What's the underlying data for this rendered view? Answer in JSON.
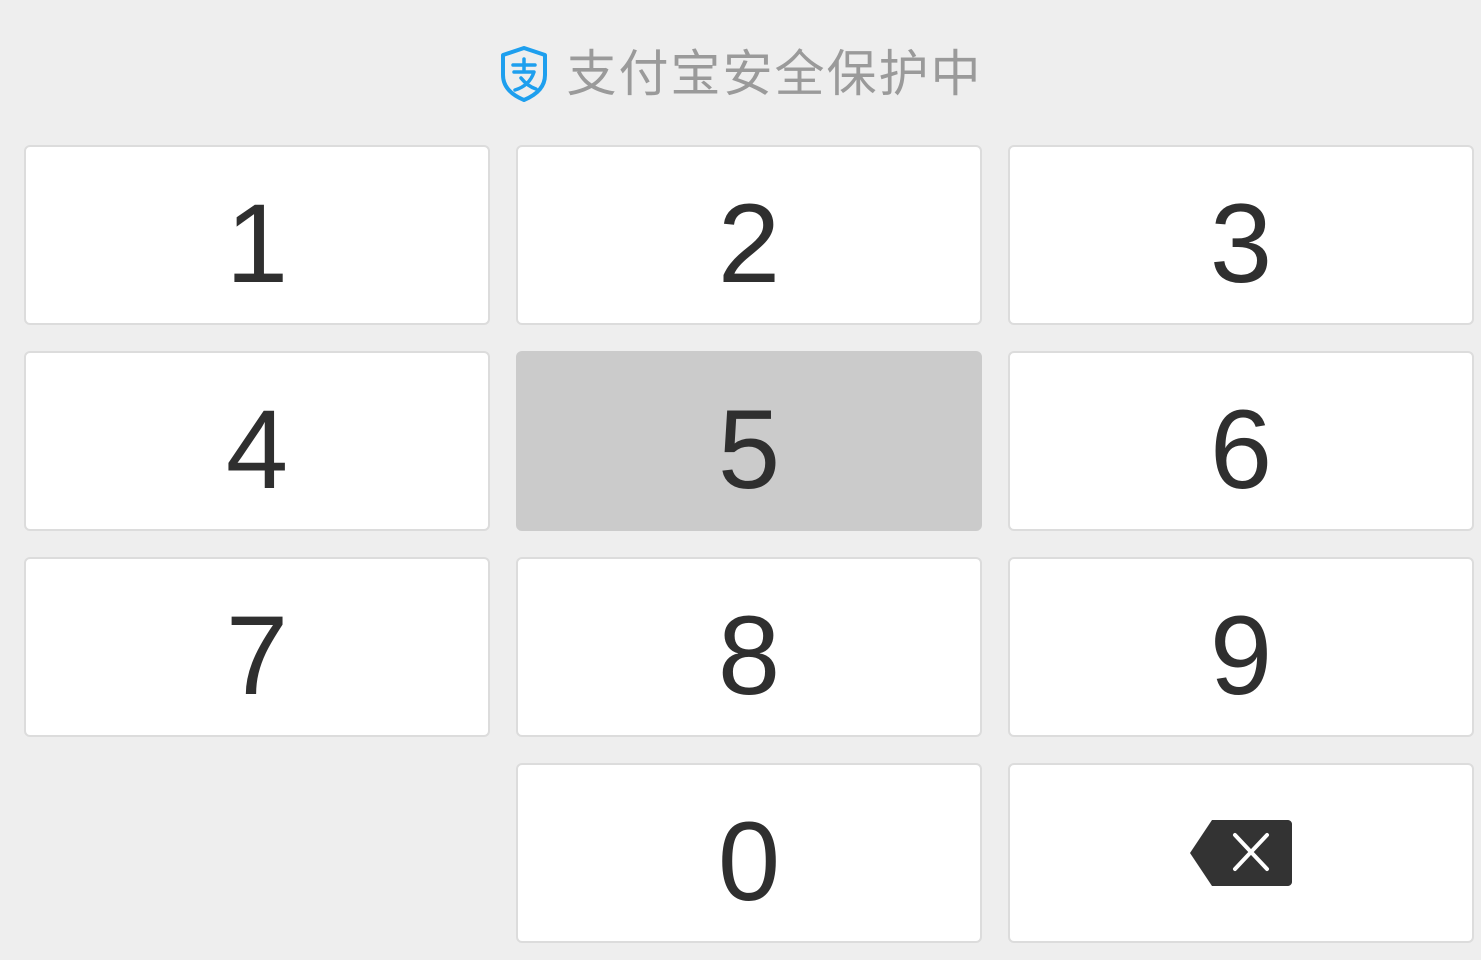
{
  "header": {
    "title": "支付宝安全保护中",
    "icon": "alipay-shield-icon",
    "icon_color": "#1e9fee"
  },
  "keypad": {
    "keys": [
      "1",
      "2",
      "3",
      "4",
      "5",
      "6",
      "7",
      "8",
      "9",
      "0"
    ],
    "pressed_key": "5",
    "backspace_icon": "backspace-icon"
  },
  "colors": {
    "background": "#eeeeee",
    "key": "#ffffff",
    "key_pressed": "#cbcbcb",
    "digit": "#2f2f2f",
    "title": "#9a9a9a"
  }
}
